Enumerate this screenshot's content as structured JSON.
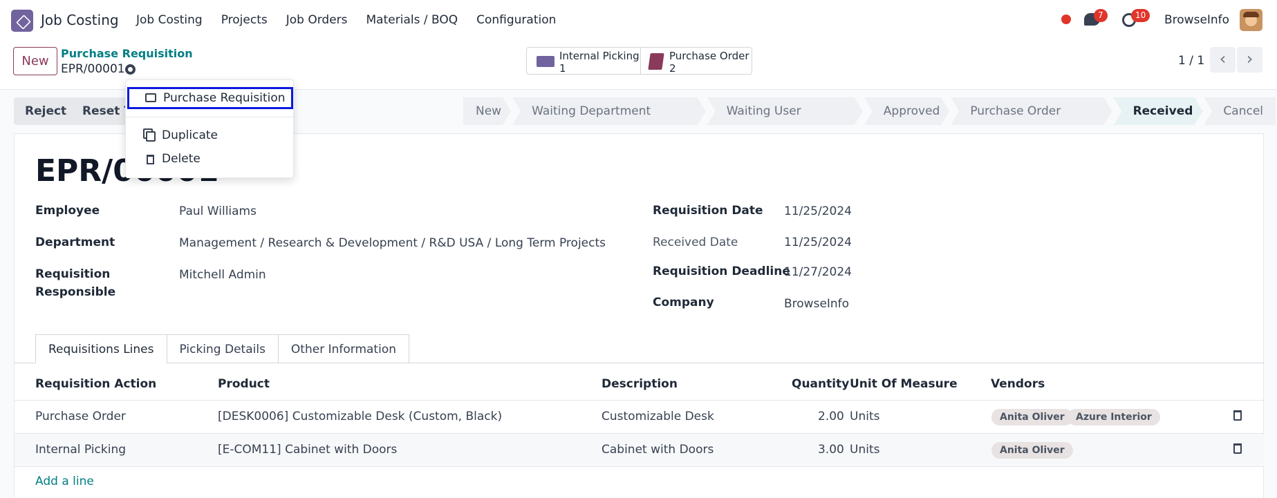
{
  "navbar": {
    "app_name": "Job Costing",
    "menu": [
      "Job Costing",
      "Projects",
      "Job Orders",
      "Materials / BOQ",
      "Configuration"
    ],
    "messages_badge": "7",
    "activities_badge": "10",
    "user_name": "BrowseInfo"
  },
  "control_panel": {
    "new_label": "New",
    "breadcrumb_parent": "Purchase Requisition",
    "breadcrumb_current": "EPR/00001",
    "smart_buttons": [
      {
        "label": "Internal Picking",
        "count": "1",
        "icon": "truck-icon"
      },
      {
        "label": "Purchase Order",
        "count": "2",
        "icon": "book-icon"
      }
    ],
    "pager": "1 / 1"
  },
  "actions": {
    "reject": "Reject",
    "reset": "Reset To"
  },
  "stages": [
    {
      "label": "New",
      "active": false
    },
    {
      "label": "Waiting Department Approval",
      "active": false
    },
    {
      "label": "Waiting User Approved",
      "active": false
    },
    {
      "label": "Approved",
      "active": false
    },
    {
      "label": "Purchase Order Created",
      "active": false
    },
    {
      "label": "Received",
      "active": true
    },
    {
      "label": "Cancel",
      "active": false
    }
  ],
  "form": {
    "name": "EPR/00001",
    "employee_label": "Employee",
    "employee": "Paul Williams",
    "department_label": "Department",
    "department": "Management / Research & Development / R&D USA / Long Term Projects",
    "responsible_label_1": "Requisition",
    "responsible_label_2": "Responsible",
    "responsible": "Mitchell Admin",
    "req_date_label": "Requisition Date",
    "req_date": "11/25/2024",
    "received_date_label": "Received Date",
    "received_date": "11/25/2024",
    "deadline_label": "Requisition Deadline",
    "deadline": "11/27/2024",
    "company_label": "Company",
    "company": "BrowseInfo"
  },
  "tabs": [
    "Requisitions Lines",
    "Picking Details",
    "Other Information"
  ],
  "lines": {
    "headers": [
      "Requisition Action",
      "Product",
      "Description",
      "Quantity",
      "Unit Of Measure",
      "Vendors"
    ],
    "rows": [
      {
        "action": "Purchase Order",
        "product": "[DESK0006] Customizable Desk (Custom, Black)",
        "description": "Customizable Desk",
        "quantity": "2.00",
        "uom": "Units",
        "vendors": [
          "Anita Oliver",
          "Azure Interior"
        ]
      },
      {
        "action": "Internal Picking",
        "product": "[E-COM11] Cabinet with Doors",
        "description": "Cabinet with Doors",
        "quantity": "3.00",
        "uom": "Units",
        "vendors": [
          "Anita Oliver"
        ]
      }
    ],
    "add_line": "Add a line"
  },
  "dropdown": {
    "print_item": "Purchase Requisition",
    "duplicate": "Duplicate",
    "delete": "Delete"
  },
  "colors": {
    "brand": "#71639e",
    "primary": "#8a3a5a",
    "link": "#017e84",
    "focus_outline": "#0b19e0"
  }
}
